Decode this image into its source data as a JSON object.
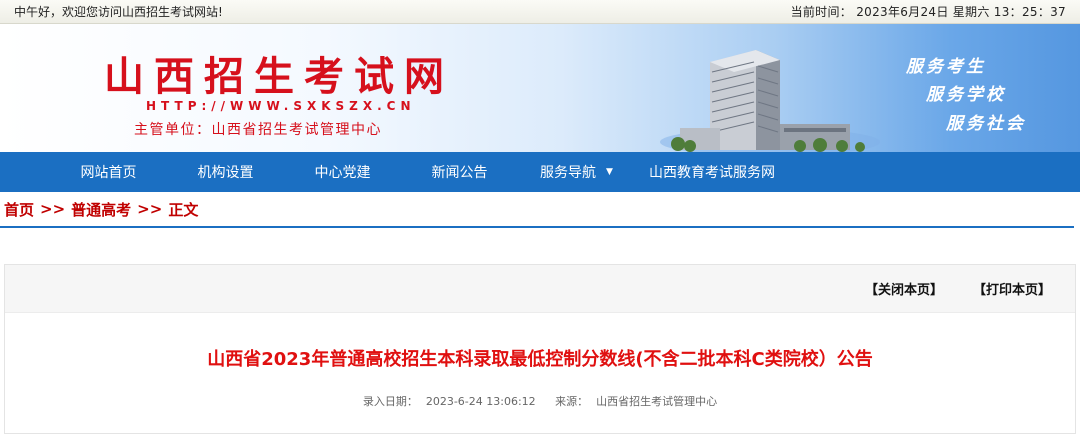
{
  "topbar": {
    "greeting": "中午好，欢迎您访问山西招生考试网站!",
    "time_label": "当前时间：",
    "time_value": "2023年6月24日 星期六 13：25：37"
  },
  "banner": {
    "title": "山西招生考试网",
    "url": "HTTP://WWW.SXKSZX.CN",
    "org": "主管单位：山西省招生考试管理中心",
    "slogans": [
      "服务考生",
      "服务学校",
      "服务社会"
    ]
  },
  "nav": {
    "items": [
      "网站首页",
      "机构设置",
      "中心党建",
      "新闻公告",
      "服务导航",
      "山西教育考试服务网"
    ],
    "dropdown_caret": "▼"
  },
  "breadcrumb": {
    "items": [
      "首页",
      "普通高考",
      "正文"
    ],
    "separator": ">>"
  },
  "article": {
    "close_label": "【关闭本页】",
    "print_label": "【打印本页】",
    "title": "山西省2023年普通高校招生本科录取最低控制分数线(不含二批本科C类院校）公告",
    "date_label": "录入日期：",
    "date_value": "2023-6-24 13:06:12",
    "source_label": "来源：",
    "source_value": "山西省招生考试管理中心"
  },
  "colors": {
    "brand_red": "#d6101c",
    "nav_blue": "#1b6fc2",
    "title_red": "#e01010"
  }
}
